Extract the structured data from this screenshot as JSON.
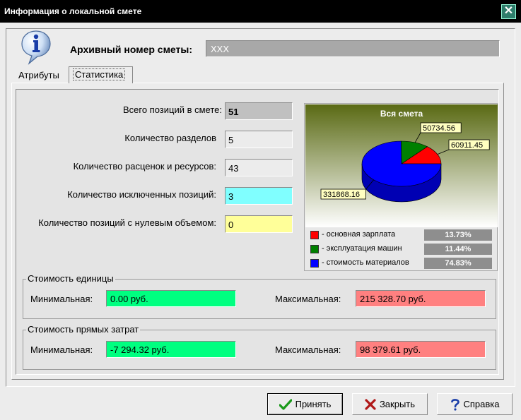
{
  "window": {
    "title": "Информация о локальной смете",
    "close_glyph": "✕"
  },
  "header": {
    "archive_label": "Архивный номер сметы:",
    "archive_value": "XXX"
  },
  "tabs": [
    {
      "label": "Атрибуты",
      "active": false
    },
    {
      "label": "Статистика",
      "active": true
    }
  ],
  "stats": [
    {
      "label": "Всего позиций в смете:",
      "value": "51",
      "color": "#c0c0c0",
      "bold": true
    },
    {
      "label": "Количество разделов",
      "value": "5",
      "color": "#ececec"
    },
    {
      "label": "Количество расценок и ресурсов:",
      "value": "43",
      "color": "#ececec"
    },
    {
      "label": "Количество исключенных позиций:",
      "value": "3",
      "color": "#80ffff"
    },
    {
      "label": "Количество позиций с нулевым объемом:",
      "value": "0",
      "color": "#ffff99"
    }
  ],
  "chart_data": {
    "type": "pie",
    "title": "Вся смета",
    "series": [
      {
        "name": "- основная зарплата",
        "value": 60911.45,
        "value_label": "60911.45",
        "percent": "13.73%",
        "color": "#ff0000"
      },
      {
        "name": "- эксплуатация машин",
        "value": 50734.56,
        "value_label": "50734.56",
        "percent": "11.44%",
        "color": "#008000"
      },
      {
        "name": "- стоимость материалов",
        "value": 331868.16,
        "value_label": "331868.16",
        "percent": "74.83%",
        "color": "#0000ff"
      }
    ]
  },
  "unit_cost": {
    "title": "Стоимость единицы",
    "min_label": "Минимальная:",
    "min_value": "0.00 руб.",
    "max_label": "Максимальная:",
    "max_value": "215 328.70 руб."
  },
  "direct_cost": {
    "title": "Стоимость прямых затрат",
    "min_label": "Минимальная:",
    "min_value": "-7 294.32 руб.",
    "max_label": "Максимальная:",
    "max_value": "98 379.61 руб."
  },
  "colors": {
    "min_bg": "#00ff80",
    "max_bg": "#ff8080"
  },
  "buttons": {
    "ok": {
      "label": "Принять",
      "icon": "checkmark-icon"
    },
    "close": {
      "label": "Закрыть",
      "icon": "x-mark-icon"
    },
    "help": {
      "label": "Справка",
      "icon": "question-icon"
    }
  }
}
